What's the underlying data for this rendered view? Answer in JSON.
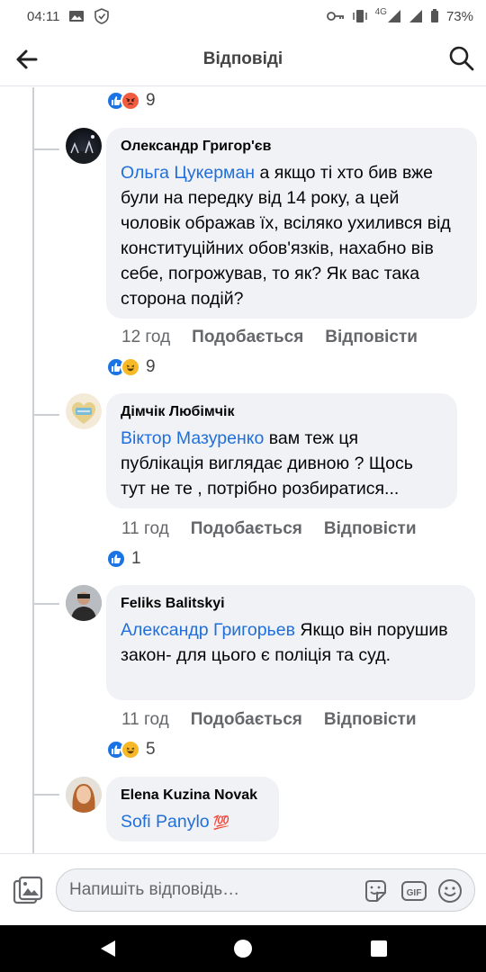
{
  "status_bar": {
    "time": "04:11",
    "battery": "73%",
    "network": "4G"
  },
  "header": {
    "title": "Відповіді"
  },
  "top_reactions": {
    "count": "9"
  },
  "comments": [
    {
      "author": "Олександр Григор'єв",
      "mention": "Ольга Цукерман",
      "text": " а якщо ті хто бив вже були на передку від 14 року, а цей чоловік ображав їх, всіляко ухилився від конституційних обов'язків, нахабно вів себе, погрожував, то як? Як вас така сторона подій?",
      "time": "12 год",
      "like_label": "Подобається",
      "reply_label": "Відповісти",
      "reactions_count": "9"
    },
    {
      "author": "Дімчік Любімчік",
      "mention": "Віктор Мазуренко",
      "text": " вам теж ця публікація виглядає дивною ? Щось тут не те , потрібно розбиратися...",
      "time": "11 год",
      "like_label": "Подобається",
      "reply_label": "Відповісти",
      "reactions_count": "1"
    },
    {
      "author": "Feliks Balitskyi",
      "mention": "Александр Григорьев",
      "text": " Якщо він порушив закон- для цього є поліція та суд.",
      "time": "11 год",
      "like_label": "Подобається",
      "reply_label": "Відповісти",
      "reactions_count": "5"
    },
    {
      "author": "Elena Kuzina Novak",
      "mention": "Sofi Panylo",
      "text": " 💯"
    }
  ],
  "composer": {
    "placeholder": "Напишіть відповідь…"
  },
  "colors": {
    "link": "#216fdb",
    "bubble": "#f0f2f5",
    "like": "#1b74e4"
  }
}
